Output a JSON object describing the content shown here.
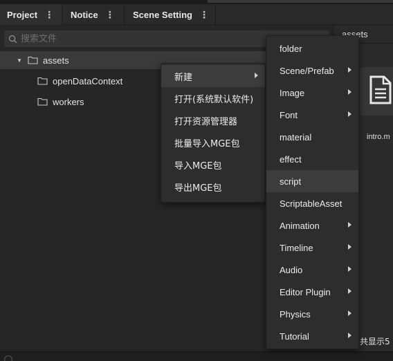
{
  "tabs": [
    {
      "label": "Project",
      "menu_glyph": "⋮"
    },
    {
      "label": "Notice",
      "menu_glyph": "⋮"
    },
    {
      "label": "Scene Setting",
      "menu_glyph": "⋮"
    }
  ],
  "search": {
    "placeholder": "搜索文件"
  },
  "tree": {
    "root": {
      "label": "assets",
      "expanded": true
    },
    "children": [
      {
        "label": "openDataContext"
      },
      {
        "label": "workers"
      }
    ]
  },
  "right_panel": {
    "header": "assets",
    "file_name": "intro.m",
    "footer": "共显示5"
  },
  "context_menu": {
    "items": [
      {
        "label": "新建",
        "submenu": true
      },
      {
        "label": "打开(系统默认软件)"
      },
      {
        "label": "打开资源管理器"
      },
      {
        "label": "批量导入MGE包"
      },
      {
        "label": "导入MGE包"
      },
      {
        "label": "导出MGE包"
      }
    ]
  },
  "submenu": {
    "hovered": "script",
    "items": [
      {
        "label": "folder"
      },
      {
        "label": "Scene/Prefab",
        "submenu": true
      },
      {
        "label": "Image",
        "submenu": true
      },
      {
        "label": "Font",
        "submenu": true
      },
      {
        "label": "material"
      },
      {
        "label": "effect"
      },
      {
        "label": "script"
      },
      {
        "label": "ScriptableAsset"
      },
      {
        "label": "Animation",
        "submenu": true
      },
      {
        "label": "Timeline",
        "submenu": true
      },
      {
        "label": "Audio",
        "submenu": true
      },
      {
        "label": "Editor Plugin",
        "submenu": true
      },
      {
        "label": "Physics",
        "submenu": true
      },
      {
        "label": "Tutorial",
        "submenu": true
      }
    ]
  },
  "colors": {
    "background": "#262626",
    "menu_bg": "#2d2d2d",
    "hover": "#3c3c3c",
    "text": "#e6e6e6"
  }
}
